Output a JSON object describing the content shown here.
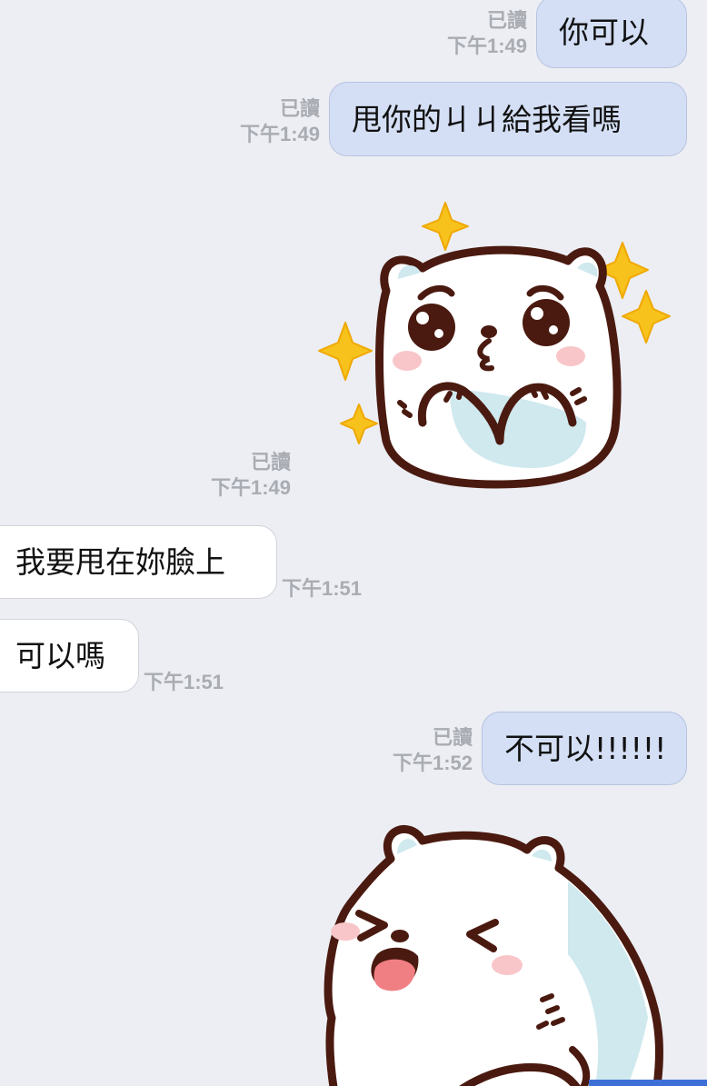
{
  "messages": [
    {
      "id": "m1",
      "direction": "outgoing",
      "text": "你可以",
      "read": "已讀",
      "time": "下午1:49"
    },
    {
      "id": "m2",
      "direction": "outgoing",
      "text": "甩你的ㄐㄐ給我看嗎",
      "read": "已讀",
      "time": "下午1:49"
    },
    {
      "id": "m3",
      "direction": "outgoing",
      "sticker": "bear-pleading-sparkles-sticker",
      "read": "已讀",
      "time": "下午1:49"
    },
    {
      "id": "m4",
      "direction": "incoming",
      "text": "我要甩在妳臉上",
      "time": "下午1:51"
    },
    {
      "id": "m5",
      "direction": "incoming",
      "text": "可以嗎",
      "time": "下午1:51"
    },
    {
      "id": "m6",
      "direction": "outgoing",
      "text": "不可以!!!!!!",
      "read": "已讀",
      "time": "下午1:52"
    },
    {
      "id": "m7",
      "direction": "outgoing",
      "sticker": "bear-tongue-out-sticker"
    }
  ],
  "colors": {
    "background": "#eceef3",
    "outgoing_bubble": "#d4dff5",
    "incoming_bubble": "#ffffff",
    "meta_text": "#a9acb3",
    "sparkle": "#f7c21c",
    "bear_outline": "#4a1a10",
    "bear_blush": "#f8c6c9",
    "bear_shadow": "#cfe9ee"
  }
}
